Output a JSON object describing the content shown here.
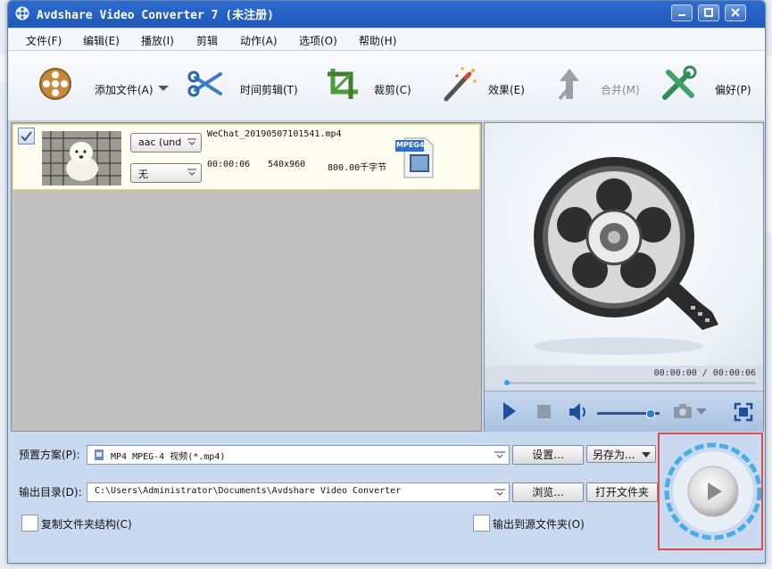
{
  "window": {
    "title": "Avdshare Video Converter 7 (未注册)"
  },
  "menu": [
    "文件(F)",
    "编辑(E)",
    "播放(I)",
    "剪辑",
    "动作(A)",
    "选项(O)",
    "帮助(H)"
  ],
  "toolbar": {
    "add_file": "添加文件(A)",
    "trim": "时间剪辑(T)",
    "crop": "裁剪(C)",
    "effect": "效果(E)",
    "merge": "合并(M)",
    "prefs": "偏好(P)"
  },
  "file": {
    "name": "WeChat_20190507101541.mp4",
    "audio_track": "aac (und",
    "subtitle": "无",
    "duration": "00:00:06",
    "resolution": "540x960",
    "size": "800.00千字节",
    "format_badge": "MPEG4"
  },
  "preview": {
    "time": "00:00:00 / 00:00:06",
    "volume": 0.82
  },
  "bottom": {
    "preset_label": "预置方案(P):",
    "preset_value": "MP4 MPEG-4 视频(*.mp4)",
    "settings_btn": "设置...",
    "save_as_btn": "另存为...",
    "output_label": "输出目录(D):",
    "output_value": "C:\\Users\\Administrator\\Documents\\Avdshare Video Converter",
    "browse_btn": "浏览...",
    "open_folder_btn": "打开文件夹",
    "copy_structure": "复制文件夹结构(C)",
    "output_to_source": "输出到源文件夹(O)"
  },
  "colors": {
    "title_bar": "#2058b8",
    "highlight_border": "#e24b4b",
    "selected_row": "#fdfdf0"
  }
}
